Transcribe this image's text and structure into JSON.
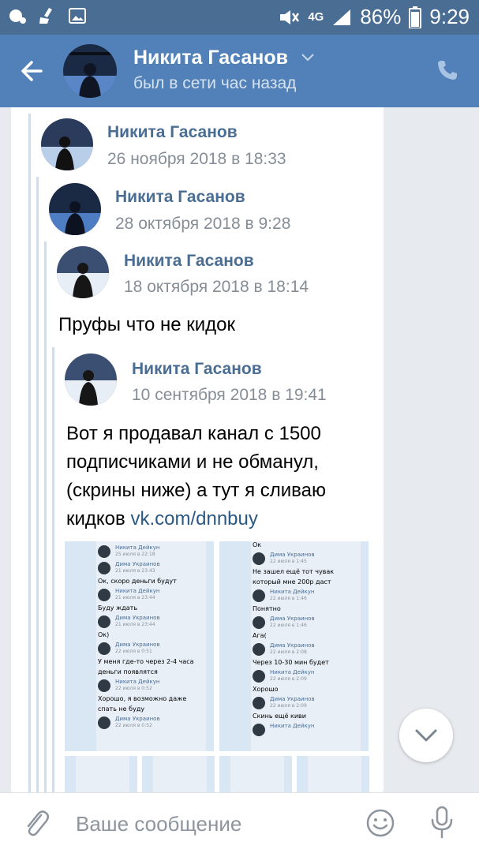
{
  "status_bar": {
    "network": "4G",
    "battery": "86%",
    "time": "9:29"
  },
  "header": {
    "name": "Никита Гасанов",
    "status": "был в сети час назад"
  },
  "message": {
    "forwards": [
      {
        "name": "Никита Гасанов",
        "date": "26 ноября 2018 в 18:33"
      },
      {
        "name": "Никита Гасанов",
        "date": "28 октября 2018 в 9:28"
      },
      {
        "name": "Никита Гасанов",
        "date": "18 октября 2018 в 18:14"
      },
      {
        "name": "Никита Гасанов",
        "date": "10 сентября 2018 в 19:41"
      }
    ],
    "text1": "Пруфы что не кидок",
    "text2_lines": [
      "Вот я продавал канал с 1500",
      "подписчиками и не обманул,",
      "(скрины ниже) а тут я сливаю"
    ],
    "text2_last": "кидков ",
    "link": "vk.com/dnnbuy",
    "screenshot1": [
      {
        "type": "n",
        "text": "Никита Дейкун"
      },
      {
        "type": "d",
        "text": "25 июля в 22:18"
      },
      {
        "type": "n",
        "text": "Дима Украинов"
      },
      {
        "type": "d",
        "text": "21 июля в 23:43"
      },
      {
        "type": "t",
        "text": "Ок, скоро деньги будут"
      },
      {
        "type": "n",
        "text": "Никита Дейкун"
      },
      {
        "type": "d",
        "text": "21 июля в 23:44"
      },
      {
        "type": "t",
        "text": "Буду ждать"
      },
      {
        "type": "n",
        "text": "Дима Украинов"
      },
      {
        "type": "d",
        "text": "21 июля в 23:44"
      },
      {
        "type": "t",
        "text": "Ок)"
      },
      {
        "type": "n",
        "text": "Дима Украинов"
      },
      {
        "type": "d",
        "text": "22 июля в 0:51"
      },
      {
        "type": "t",
        "text": "У меня где-то через 2-4 часа"
      },
      {
        "type": "t",
        "text": "деньги появлятся"
      },
      {
        "type": "n",
        "text": "Никита Дейкун"
      },
      {
        "type": "d",
        "text": "22 июля в 0:52"
      },
      {
        "type": "t",
        "text": "Хорошо, я возможно даже"
      },
      {
        "type": "t",
        "text": "спать не буду"
      },
      {
        "type": "n",
        "text": "Дима Украинов"
      },
      {
        "type": "d",
        "text": "22 июля в 0:52"
      }
    ],
    "screenshot2": [
      {
        "type": "t",
        "text": "Ок"
      },
      {
        "type": "n",
        "text": "Дима Украинов"
      },
      {
        "type": "d",
        "text": "22 июля в 1:45"
      },
      {
        "type": "t",
        "text": "Не зашел ещё тот чувак"
      },
      {
        "type": "t",
        "text": "который мне 200р даст"
      },
      {
        "type": "n",
        "text": "Никита Дейкун"
      },
      {
        "type": "d",
        "text": "22 июля в 1:46"
      },
      {
        "type": "t",
        "text": "Понятно"
      },
      {
        "type": "n",
        "text": "Дима Украинов"
      },
      {
        "type": "d",
        "text": "22 июля в 1:46"
      },
      {
        "type": "t",
        "text": "Ага("
      },
      {
        "type": "n",
        "text": "Дима Украинов"
      },
      {
        "type": "d",
        "text": "22 июля в 2:08"
      },
      {
        "type": "t",
        "text": "Через 10-30 мин будет"
      },
      {
        "type": "n",
        "text": "Никита Дейкун"
      },
      {
        "type": "d",
        "text": "22 июля в 2:09"
      },
      {
        "type": "t",
        "text": "Хорошо"
      },
      {
        "type": "n",
        "text": "Дима Украинов"
      },
      {
        "type": "d",
        "text": "22 июля в 2:09"
      },
      {
        "type": "t",
        "text": "Скинь ещё киви"
      },
      {
        "type": "n",
        "text": "Никита Дейкун"
      }
    ]
  },
  "compose": {
    "placeholder": "Ваше сообщение"
  },
  "colors": {
    "status_bar": "#4a6d94",
    "header": "#5181b8",
    "name_link": "#4a6d94",
    "background": "#e7ebf0"
  }
}
